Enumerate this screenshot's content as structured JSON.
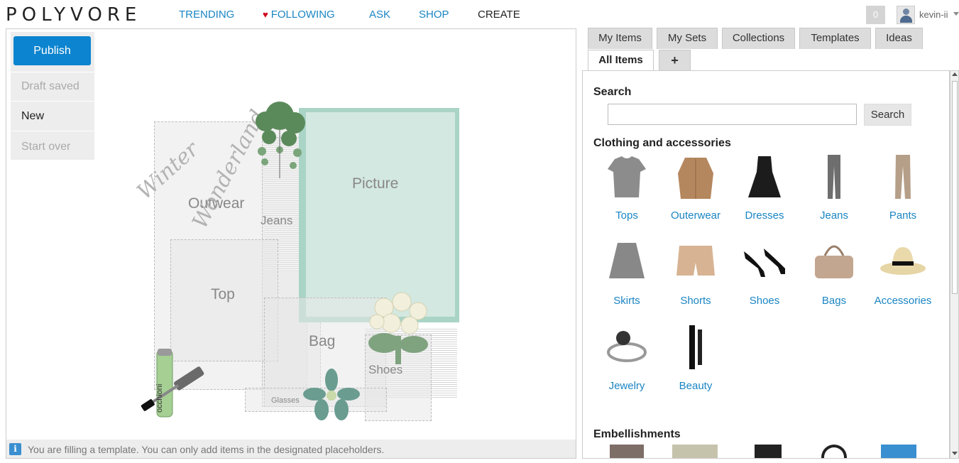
{
  "brand": "POLYVORE",
  "nav": {
    "trending": "TRENDING",
    "following": "FOLLOWING",
    "ask": "ASK",
    "shop": "SHOP",
    "create": "CREATE"
  },
  "user": {
    "notifications": "0",
    "name": "kevin-ii"
  },
  "sidebar": {
    "publish": "Publish",
    "draft": "Draft saved",
    "new": "New",
    "start_over": "Start over"
  },
  "template": {
    "placeholders": {
      "outwear": "Outwear",
      "jeans": "Jeans",
      "picture": "Picture",
      "top": "Top",
      "bag": "Bag",
      "shoes": "Shoes",
      "glasses": "Glasses"
    },
    "script_text_1": "Winter",
    "script_text_2": "Wonderland",
    "mascara_text": "occhioni"
  },
  "footer": {
    "message": "You are filling a template. You can only add items in the designated placeholders."
  },
  "tabs": [
    "My Items",
    "My Sets",
    "Collections",
    "Templates",
    "Ideas",
    "All Items",
    "+"
  ],
  "search": {
    "title": "Search",
    "button": "Search",
    "placeholder": ""
  },
  "clothing": {
    "title": "Clothing and accessories",
    "categories": [
      "Tops",
      "Outerwear",
      "Dresses",
      "Jeans",
      "Pants",
      "Skirts",
      "Shorts",
      "Shoes",
      "Bags",
      "Accessories",
      "Jewelry",
      "Beauty"
    ]
  },
  "embellishments": {
    "title": "Embellishments"
  },
  "colors": {
    "accent": "#1a85c4",
    "publish": "#0c84cf",
    "picture_frame": "#a9d4c6"
  }
}
